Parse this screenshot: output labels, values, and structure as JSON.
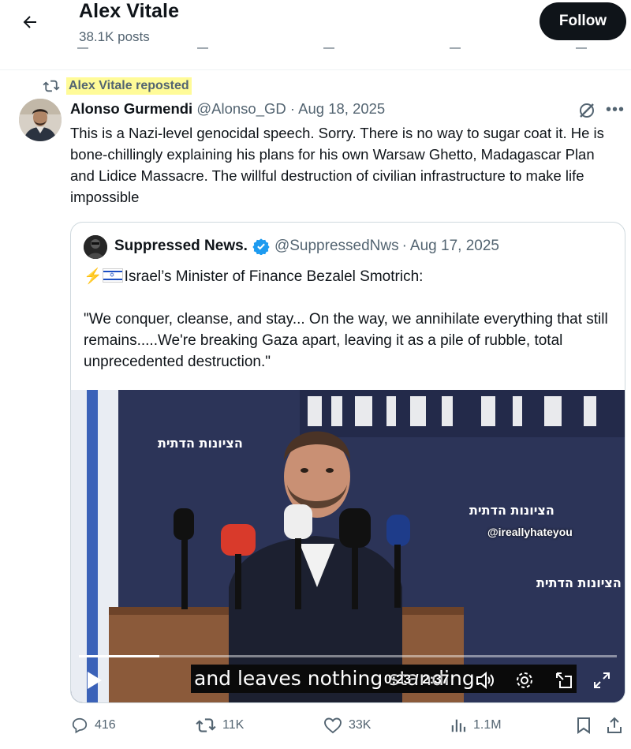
{
  "header": {
    "back_label": "Back",
    "name": "Alex Vitale",
    "posts": "38.1K posts",
    "follow_label": "Follow"
  },
  "repost": {
    "label": "Alex Vitale reposted"
  },
  "post": {
    "author_name": "Alonso Gurmendi",
    "author_handle": "@Alonso_GD",
    "date": "Aug 18, 2025",
    "more_label": "•••",
    "text": "This is a Nazi-level genocidal speech. Sorry. There is no way to sugar coat it. He is bone-chillingly explaining his plans for his own Warsaw Ghetto, Madagascar Plan and Lidice Massacre. The willful destruction of civilian infrastructure to make life impossible"
  },
  "quote": {
    "author_name": "Suppressed News.",
    "author_handle": "@SuppressedNws",
    "date": "Aug 17, 2025",
    "lightning": "⚡",
    "line1": "Israel’s Minister of Finance Bezalel Smotrich:",
    "line2": "\"We conquer, cleanse, and stay... On the way, we annihilate everything that still remains.....We're breaking Gaza apart, leaving it as a pile of rubble, total unprecedented destruction.\""
  },
  "video": {
    "subtitle": "and leaves nothing standing.",
    "time": "0:23 / 2:37",
    "watermark": "@ireallyhateyou",
    "progress": 0.15,
    "banner_text": "הציונות הדתית"
  },
  "actions": {
    "replies": "416",
    "reposts": "11K",
    "likes": "33K",
    "views": "1.1M"
  },
  "colors": {
    "text": "#0f1419",
    "muted": "#536471",
    "verified": "#1d9bf0",
    "highlight": "#fffb98",
    "video_bg": "#2c3458"
  }
}
